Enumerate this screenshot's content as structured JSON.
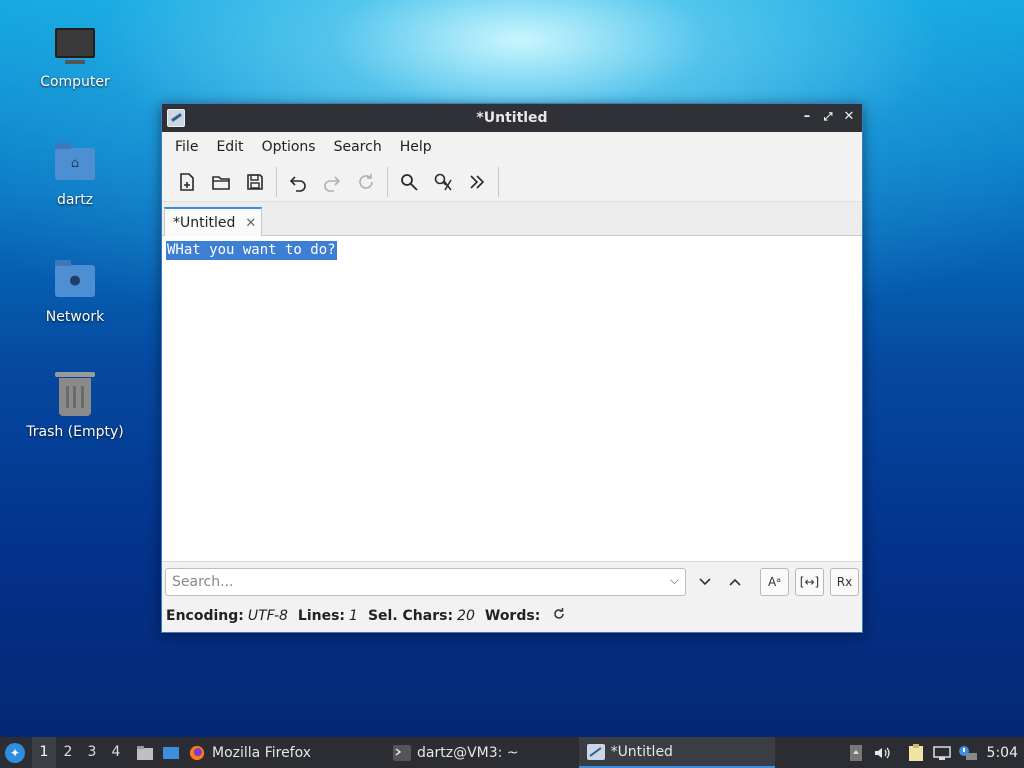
{
  "desktop": {
    "icons": [
      {
        "label": "Computer"
      },
      {
        "label": "dartz"
      },
      {
        "label": "Network"
      },
      {
        "label": "Trash (Empty)"
      }
    ]
  },
  "window": {
    "title": "*Untitled",
    "menu": [
      "File",
      "Edit",
      "Options",
      "Search",
      "Help"
    ],
    "tab": {
      "label": "*Untitled",
      "close": "✕"
    },
    "editor": {
      "text": "WHat you want to do?"
    },
    "search": {
      "placeholder": "Search..."
    },
    "search_options": {
      "case": "Aᵃ",
      "whole_word": "[↔]",
      "regex": "Rx"
    },
    "status": {
      "encoding_label": "Encoding:",
      "encoding_value": "UTF-8",
      "lines_label": "Lines:",
      "lines_value": "1",
      "selchars_label": "Sel. Chars:",
      "selchars_value": "20",
      "words_label": "Words:"
    }
  },
  "taskbar": {
    "workspaces": [
      "1",
      "2",
      "3",
      "4"
    ],
    "tasks": [
      {
        "label": "Mozilla Firefox"
      },
      {
        "label": "dartz@VM3: ~"
      },
      {
        "label": "*Untitled"
      }
    ],
    "clock": "5:04"
  },
  "colors": {
    "accent": "#3d8ee0",
    "selection": "#3d7fd3",
    "titlebar": "#2f3136"
  }
}
